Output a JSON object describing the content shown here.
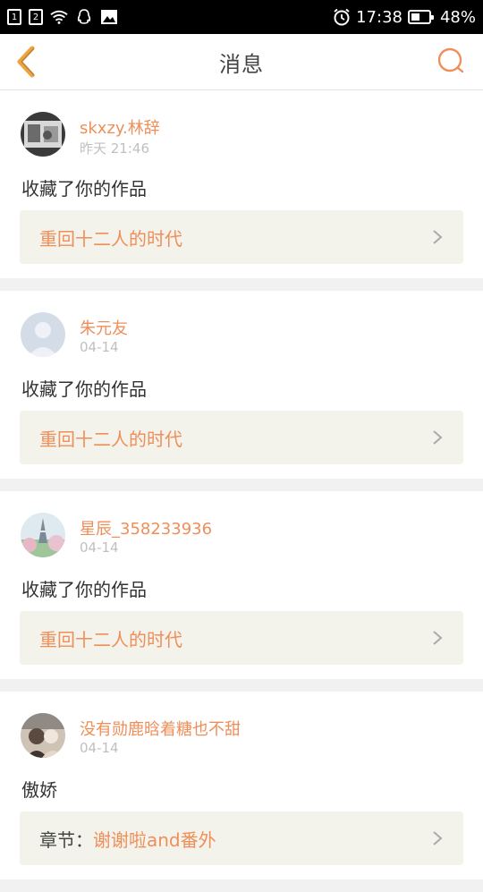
{
  "status_bar": {
    "sim1": "1",
    "sim2": "2",
    "time": "17:38",
    "battery": "48%",
    "battery_level": 0.48
  },
  "header": {
    "title": "消息"
  },
  "messages": [
    {
      "username": "skxzy.林辞",
      "time": "昨天 21:46",
      "action": "收藏了你的作品",
      "work_title": "重回十二人的时代",
      "avatar_icon": "photo-avatar"
    },
    {
      "username": "朱元友",
      "time": "04-14",
      "action": "收藏了你的作品",
      "work_title": "重回十二人的时代",
      "avatar_icon": "default-avatar"
    },
    {
      "username": "星辰_358233936",
      "time": "04-14",
      "action": "收藏了你的作品",
      "work_title": "重回十二人的时代",
      "avatar_icon": "tower-avatar"
    },
    {
      "username": "没有勋鹿晗着糖也不甜",
      "time": "04-14",
      "action": "傲娇",
      "work_prefix": "章节：",
      "work_title": "谢谢啦and番外",
      "avatar_icon": "photo-avatar"
    }
  ],
  "colors": {
    "accent": "#ee8f5a",
    "back_arrow": "#f0a23c",
    "card_bg": "#f3f3ec",
    "page_bg": "#f1f1f1"
  }
}
